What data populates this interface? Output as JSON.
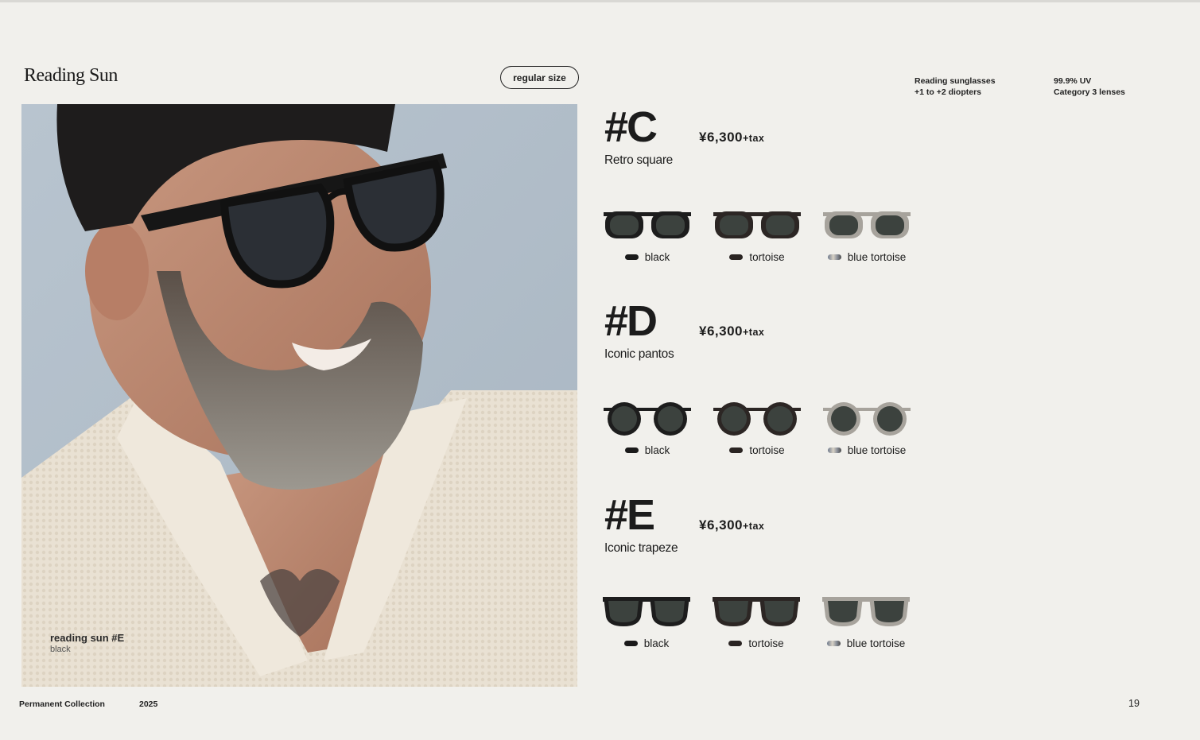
{
  "page": {
    "section_title": "Reading Sun",
    "size_badge": "regular size",
    "specs_left": [
      "Reading sunglasses",
      "+1 to +2 diopters"
    ],
    "specs_right": [
      "99.9% UV",
      "Category 3 lenses"
    ]
  },
  "photo": {
    "caption_title": "reading sun #E",
    "caption_sub": "black"
  },
  "models": [
    {
      "code": "#C",
      "price": "¥6,300",
      "tax": "+tax",
      "name": "Retro square",
      "variants": [
        {
          "label": "black",
          "frame_color": "#1d1d1d",
          "swatch": "#1a1a1a"
        },
        {
          "label": "tortoise",
          "frame_color": "#2c2624",
          "swatch": "#2a2422"
        },
        {
          "label": "blue tortoise",
          "frame_color": "#a7a39c",
          "swatch": "#8a8f98"
        }
      ]
    },
    {
      "code": "#D",
      "price": "¥6,300",
      "tax": "+tax",
      "name": "Iconic pantos",
      "variants": [
        {
          "label": "black",
          "frame_color": "#1d1d1d",
          "swatch": "#1a1a1a"
        },
        {
          "label": "tortoise",
          "frame_color": "#2c2624",
          "swatch": "#2a2422"
        },
        {
          "label": "blue tortoise",
          "frame_color": "#a7a39c",
          "swatch": "#8a8f98"
        }
      ]
    },
    {
      "code": "#E",
      "price": "¥6,300",
      "tax": "+tax",
      "name": "Iconic trapeze",
      "variants": [
        {
          "label": "black",
          "frame_color": "#1d1d1d",
          "swatch": "#1a1a1a"
        },
        {
          "label": "tortoise",
          "frame_color": "#2c2624",
          "swatch": "#2a2422"
        },
        {
          "label": "blue tortoise",
          "frame_color": "#a7a39c",
          "swatch": "#8a8f98"
        }
      ]
    }
  ],
  "footer": {
    "collection": "Permanent Collection",
    "year": "2025",
    "page_number": "19"
  },
  "colors": {
    "background": "#f1f0ec",
    "text": "#1c1c1c",
    "lens": "#3c423e"
  }
}
